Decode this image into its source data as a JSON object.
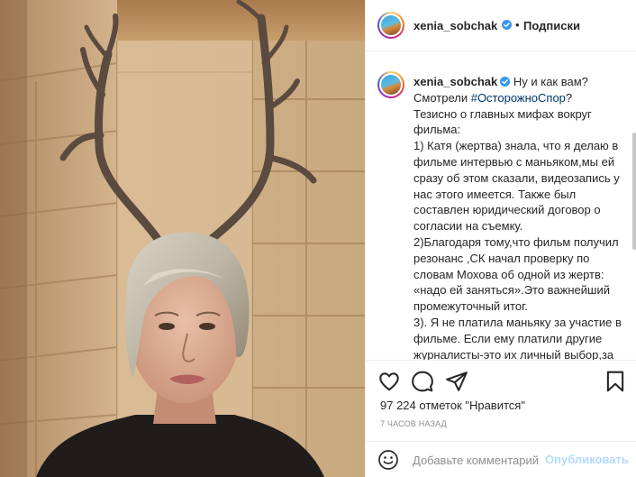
{
  "post": {
    "username": "xenia_sobchak",
    "follow_separator": "•",
    "follow_label": "Подписки",
    "caption_lead": "Ну и как вам? Смотрели ",
    "caption_hashtag": "#ОсторожноСпор",
    "caption_rest": "?\nТезисно о главных мифах вокруг фильма:\n1) Катя (жертва) знала, что я делаю в фильме интервью с маньяком,мы ей сразу об этом сказали, видеозапись у нас этого имеется. Также был составлен юридический договор о согласии на съемку.\n2)Благодаря тому,что фильм получил резонанс ,СК начал проверку по словам Мохова об одной из жертв: «надо ей заняться».Это важнейший промежуточный итог.\n3). Я не платила маньяку за участие в фильме. Если ему платили другие журналисты-это их личный выбор,за него я никого не осуждаю",
    "likes_text": "97 224 отметок \"Нравится\"",
    "timestamp": "7 ЧАСОВ НАЗАД"
  },
  "comment_box": {
    "placeholder": "Добавьте комментарий...",
    "publish_label": "Опубликовать"
  },
  "icons": {
    "verified": "verified-badge-icon",
    "like": "heart-icon",
    "comment": "speech-bubble-icon",
    "share": "paper-plane-icon",
    "save": "bookmark-icon",
    "emoji": "emoji-smile-icon"
  },
  "colors": {
    "verified_blue": "#3897f0",
    "hashtag_link": "#00376b",
    "publish_disabled": "#b3dbff",
    "muted_text": "#8e8e8e"
  }
}
